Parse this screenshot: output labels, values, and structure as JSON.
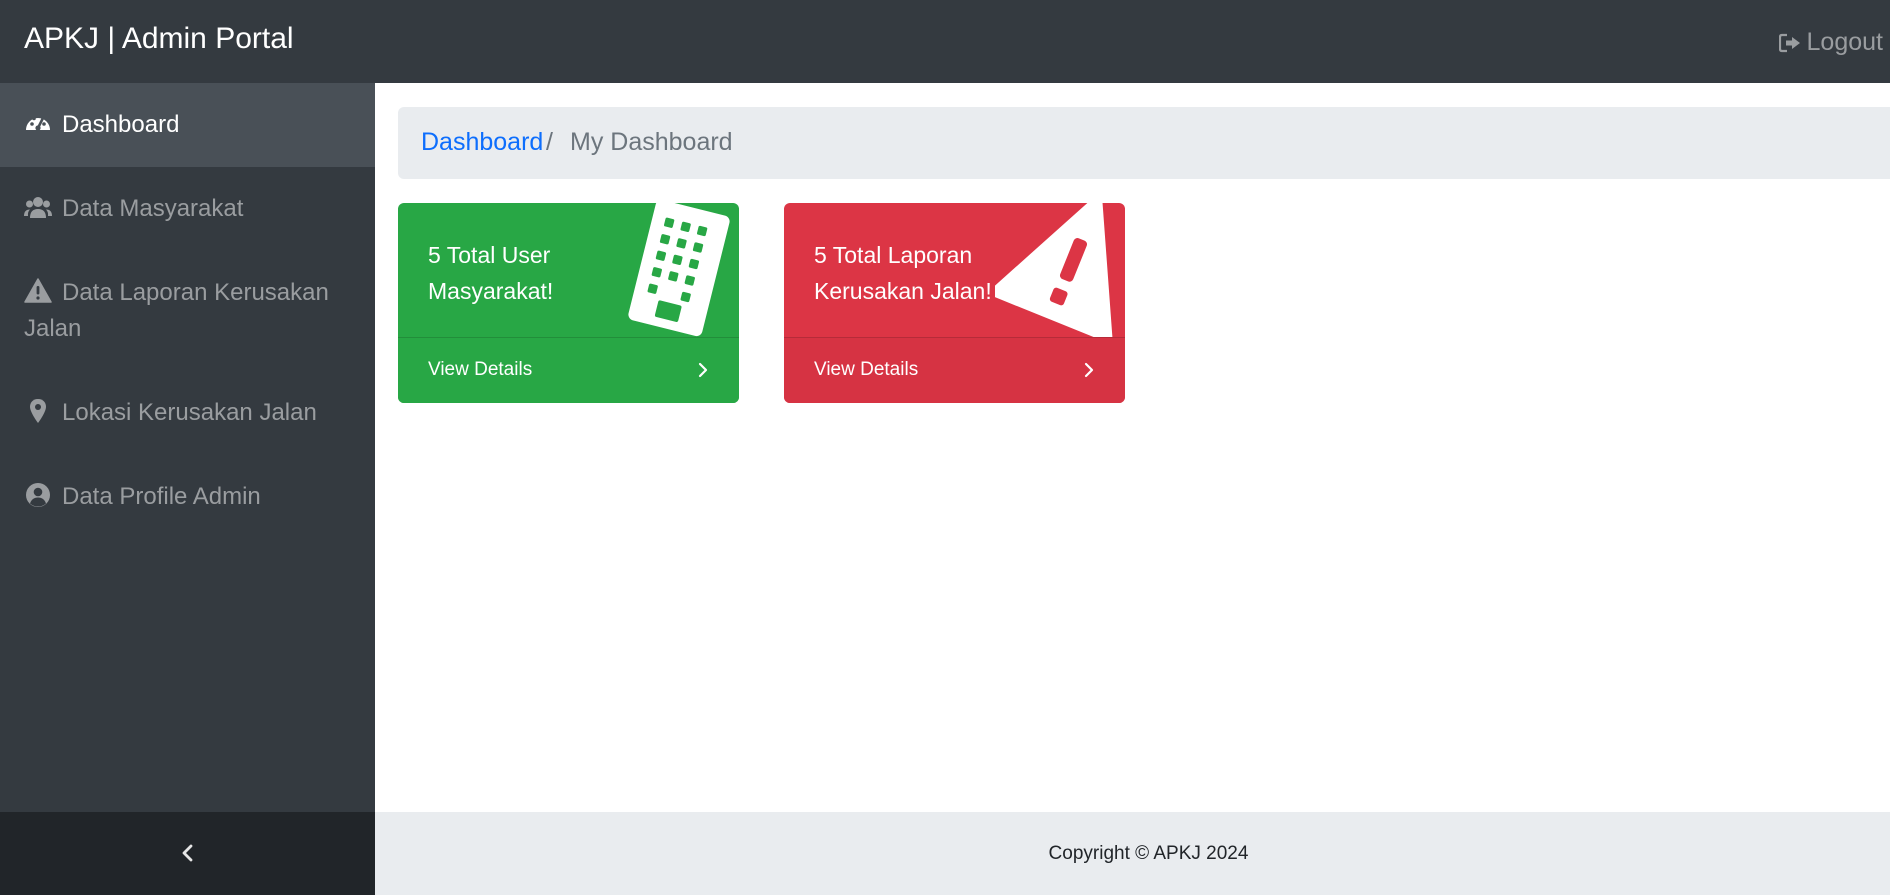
{
  "header": {
    "brand": "APKJ | Admin Portal",
    "logout_label": "Logout",
    "logout_icon": "sign-out-icon"
  },
  "sidebar": {
    "items": [
      {
        "label": "Dashboard",
        "icon": "tachometer-icon",
        "active": true
      },
      {
        "label": "Data Masyarakat",
        "icon": "users-icon",
        "active": false
      },
      {
        "label": "Data Laporan Kerusakan Jalan",
        "icon": "warning-icon",
        "active": false
      },
      {
        "label": "Lokasi Kerusakan Jalan",
        "icon": "map-marker-icon",
        "active": false
      },
      {
        "label": "Data Profile Admin",
        "icon": "user-circle-icon",
        "active": false
      }
    ],
    "toggle_icon": "chevron-left-icon"
  },
  "breadcrumb": {
    "link": "Dashboard",
    "separator": "/",
    "current": "My Dashboard"
  },
  "cards": [
    {
      "title": "5 Total User Masyarakat!",
      "footer": "View Details",
      "color": "#28a745",
      "icon": "building-icon"
    },
    {
      "title": "5 Total Laporan Kerusakan Jalan!",
      "footer": "View Details",
      "color": "#dc3545",
      "icon": "warning-icon"
    }
  ],
  "footer": {
    "copyright": "Copyright © APKJ 2024"
  },
  "colors": {
    "topbar": "#343a40",
    "sidebar": "#343a40",
    "sidebar_active": "#495057",
    "link": "#0d6efd",
    "success": "#28a745",
    "danger": "#dc3545"
  }
}
